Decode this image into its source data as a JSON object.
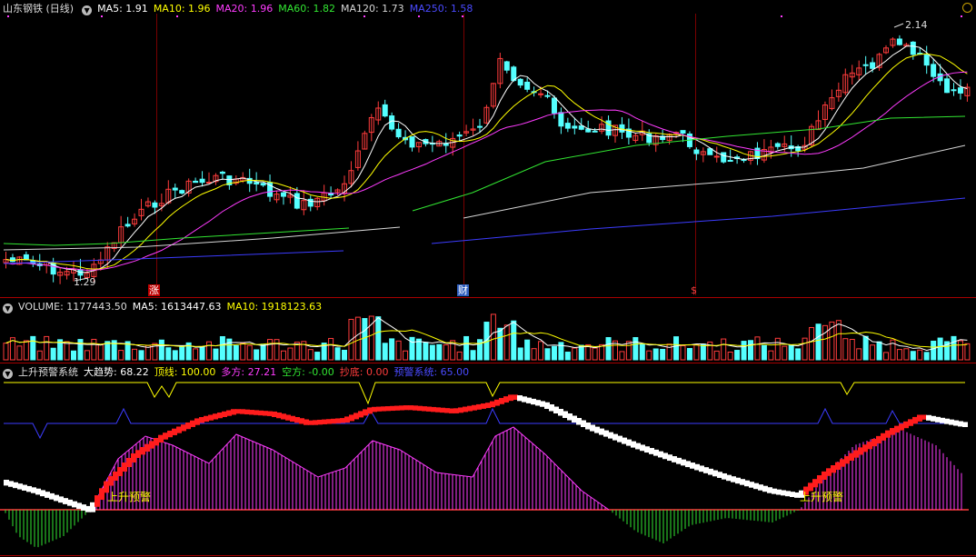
{
  "main_header": {
    "title": "山东钢铁 (日线)",
    "ma5": "MA5: 1.91",
    "ma10": "MA10: 1.96",
    "ma20": "MA20: 1.96",
    "ma60": "MA60: 1.82",
    "ma120": "MA120: 1.73",
    "ma250": "MA250: 1.58"
  },
  "price_labels": {
    "high": "2.14",
    "low": "1.29"
  },
  "event_markers": {
    "rise": "涨",
    "finance": "财",
    "dollar": "$"
  },
  "volume_header": {
    "volume": "VOLUME: 1177443.50",
    "ma5": "MA5: 1613447.63",
    "ma10": "MA10: 1918123.63"
  },
  "indicator_header": {
    "name": "上升预警系统",
    "trend": "大趋势: 68.22",
    "top": "顶线: 100.00",
    "bull": "多方: 27.21",
    "bear": "空方: -0.00",
    "bottom": "抄底: 0.00",
    "warn_sys": "预警系统: 65.00"
  },
  "signals": {
    "warn1": "上升预警",
    "warn2": "上升预警"
  },
  "colors": {
    "bg": "#000000",
    "up": "#ff3c3c",
    "down": "#54ffff",
    "ma5": "#ffffff",
    "ma10": "#ffff00",
    "ma20": "#ff3cff",
    "ma60": "#32e632",
    "ma120": "#d6d6d6",
    "ma250": "#3c3cff"
  },
  "chart_data": {
    "type": "candlestick",
    "title": "山东钢铁 (日线)",
    "close_start": 1.34,
    "close_end": 1.91,
    "period_high": 2.14,
    "period_low": 1.29,
    "last_volume": 1177443.5,
    "indicator_last": {
      "trend": 68.22,
      "top": 100.0,
      "bull": 27.21,
      "bear": 0.0,
      "bottom": 0.0,
      "warn": 65.0
    }
  }
}
